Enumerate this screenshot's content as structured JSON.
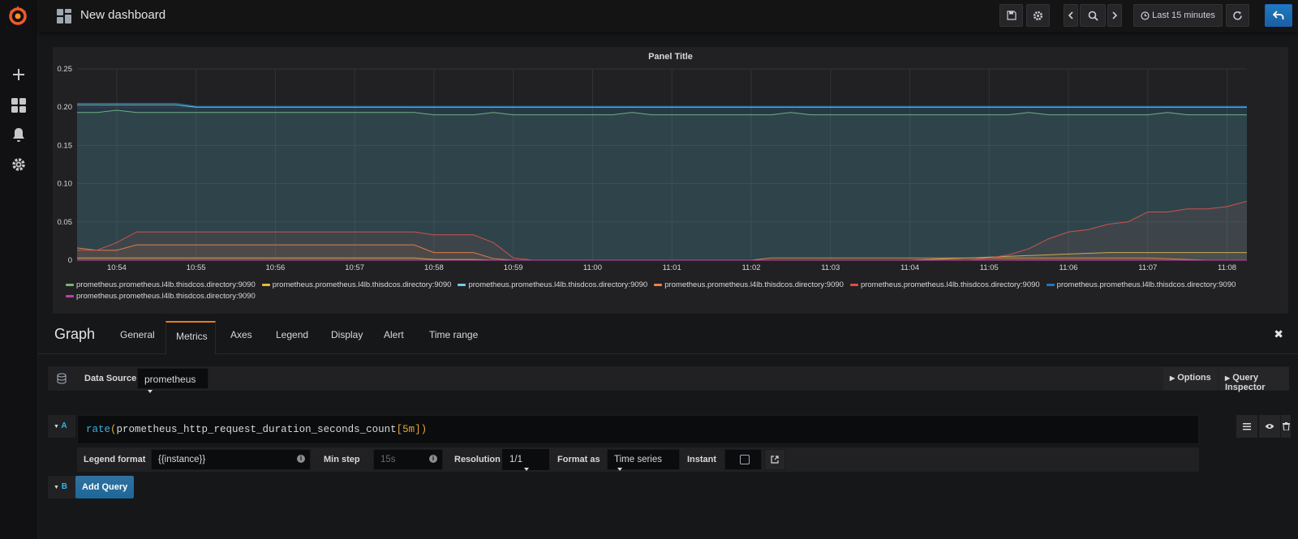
{
  "app": {
    "dashboard_title": "New dashboard",
    "time_range_label": "Last 15 minutes"
  },
  "panel": {
    "title": "Panel Title"
  },
  "chart_data": {
    "type": "area",
    "title": "Panel Title",
    "xlabel": "",
    "ylabel": "",
    "ylim": [
      0,
      0.25
    ],
    "y_ticks": [
      "0",
      "0.05",
      "0.10",
      "0.15",
      "0.20",
      "0.25"
    ],
    "x": [
      "10:53:30",
      "10:53:45",
      "10:54",
      "10:54:15",
      "10:54:30",
      "10:54:45",
      "10:55",
      "10:55:15",
      "10:55:30",
      "10:55:45",
      "10:56",
      "10:56:15",
      "10:56:30",
      "10:56:45",
      "10:57",
      "10:57:15",
      "10:57:30",
      "10:57:45",
      "10:58",
      "10:58:15",
      "10:58:30",
      "10:58:45",
      "10:59",
      "10:59:15",
      "10:59:30",
      "10:59:45",
      "11:00",
      "11:00:15",
      "11:00:30",
      "11:00:45",
      "11:01",
      "11:01:15",
      "11:01:30",
      "11:01:45",
      "11:02",
      "11:02:15",
      "11:02:30",
      "11:02:45",
      "11:03",
      "11:03:15",
      "11:03:30",
      "11:03:45",
      "11:04",
      "11:04:15",
      "11:04:30",
      "11:04:45",
      "11:05",
      "11:05:15",
      "11:05:30",
      "11:05:45",
      "11:06",
      "11:06:15",
      "11:06:30",
      "11:06:45",
      "11:07",
      "11:07:15",
      "11:07:30",
      "11:07:45",
      "11:08",
      "11:08:15"
    ],
    "x_ticks": [
      "10:54",
      "10:55",
      "10:56",
      "10:57",
      "10:58",
      "10:59",
      "11:00",
      "11:01",
      "11:02",
      "11:03",
      "11:04",
      "11:05",
      "11:06",
      "11:07",
      "11:08"
    ],
    "grid": true,
    "legend_position": "bottom",
    "series": [
      {
        "name": "prometheus.prometheus.l4lb.thisdcos.directory:9090",
        "color": "#7eb26d",
        "values": [
          0.193,
          0.193,
          0.196,
          0.193,
          0.193,
          0.193,
          0.193,
          0.193,
          0.193,
          0.193,
          0.193,
          0.193,
          0.193,
          0.193,
          0.193,
          0.193,
          0.193,
          0.193,
          0.19,
          0.19,
          0.19,
          0.193,
          0.19,
          0.19,
          0.19,
          0.19,
          0.19,
          0.19,
          0.193,
          0.19,
          0.19,
          0.19,
          0.19,
          0.19,
          0.19,
          0.19,
          0.193,
          0.19,
          0.19,
          0.19,
          0.19,
          0.19,
          0.19,
          0.19,
          0.19,
          0.19,
          0.19,
          0.19,
          0.193,
          0.19,
          0.19,
          0.19,
          0.19,
          0.19,
          0.19,
          0.193,
          0.19,
          0.19,
          0.19,
          0.19
        ]
      },
      {
        "name": "prometheus.prometheus.l4lb.thisdcos.directory:9090",
        "color": "#eab839",
        "values": [
          0.003,
          0.003,
          0.003,
          0.003,
          0.003,
          0.003,
          0.003,
          0.003,
          0.003,
          0.003,
          0.003,
          0.003,
          0.003,
          0.003,
          0.003,
          0.003,
          0.003,
          0.003,
          0.001,
          0.001,
          0.001,
          0.0,
          0.0,
          0.0,
          0.0,
          0.0,
          0.0,
          0.0,
          0.0,
          0.0,
          0.0,
          0.0,
          0.0,
          0.0,
          0.0,
          0.0,
          0.0,
          0.0,
          0.0,
          0.0,
          0.0,
          0.0,
          0.0,
          0.001,
          0.002,
          0.003,
          0.004,
          0.005,
          0.006,
          0.007,
          0.008,
          0.009,
          0.01,
          0.01,
          0.01,
          0.01,
          0.01,
          0.01,
          0.01,
          0.01
        ]
      },
      {
        "name": "prometheus.prometheus.l4lb.thisdcos.directory:9090",
        "color": "#6ed0e0",
        "values": [
          0.203,
          0.203,
          0.203,
          0.203,
          0.203,
          0.203,
          0.2,
          0.2,
          0.2,
          0.2,
          0.2,
          0.2,
          0.2,
          0.2,
          0.2,
          0.2,
          0.2,
          0.2,
          0.2,
          0.2,
          0.2,
          0.2,
          0.2,
          0.2,
          0.2,
          0.2,
          0.2,
          0.2,
          0.2,
          0.2,
          0.2,
          0.2,
          0.2,
          0.2,
          0.2,
          0.2,
          0.2,
          0.2,
          0.2,
          0.2,
          0.2,
          0.2,
          0.2,
          0.2,
          0.2,
          0.2,
          0.2,
          0.2,
          0.2,
          0.2,
          0.2,
          0.2,
          0.2,
          0.2,
          0.2,
          0.2,
          0.2,
          0.2,
          0.2,
          0.2
        ]
      },
      {
        "name": "prometheus.prometheus.l4lb.thisdcos.directory:9090",
        "color": "#ef843c",
        "values": [
          0.016,
          0.013,
          0.013,
          0.02,
          0.02,
          0.02,
          0.02,
          0.02,
          0.02,
          0.02,
          0.02,
          0.02,
          0.02,
          0.02,
          0.02,
          0.02,
          0.02,
          0.02,
          0.01,
          0.01,
          0.01,
          0.002,
          0.0,
          0.0,
          0.0,
          0.0,
          0.0,
          0.0,
          0.0,
          0.0,
          0.0,
          0.0,
          0.0,
          0.0,
          0.0,
          0.003,
          0.003,
          0.003,
          0.003,
          0.003,
          0.003,
          0.003,
          0.003,
          0.003,
          0.003,
          0.003,
          0.003,
          0.003,
          0.003,
          0.003,
          0.003,
          0.003,
          0.003,
          0.003,
          0.003,
          0.002,
          0.001,
          0.0,
          0.0,
          0.0
        ]
      },
      {
        "name": "prometheus.prometheus.l4lb.thisdcos.directory:9090",
        "color": "#e24d42",
        "values": [
          0.013,
          0.013,
          0.023,
          0.037,
          0.037,
          0.037,
          0.037,
          0.037,
          0.037,
          0.037,
          0.037,
          0.037,
          0.037,
          0.037,
          0.037,
          0.037,
          0.037,
          0.037,
          0.033,
          0.033,
          0.033,
          0.023,
          0.003,
          0.0,
          0.0,
          0.0,
          0.0,
          0.0,
          0.0,
          0.0,
          0.0,
          0.0,
          0.0,
          0.0,
          0.0,
          0.0,
          0.0,
          0.0,
          0.0,
          0.0,
          0.0,
          0.0,
          0.0,
          0.0,
          0.0,
          0.0,
          0.003,
          0.007,
          0.015,
          0.028,
          0.037,
          0.04,
          0.047,
          0.05,
          0.063,
          0.063,
          0.067,
          0.067,
          0.07,
          0.077
        ]
      },
      {
        "name": "prometheus.prometheus.l4lb.thisdcos.directory:9090",
        "color": "#1f78c1",
        "values": [
          0.205,
          0.205,
          0.205,
          0.205,
          0.205,
          0.205,
          0.201,
          0.201,
          0.201,
          0.201,
          0.201,
          0.201,
          0.201,
          0.201,
          0.201,
          0.201,
          0.201,
          0.201,
          0.201,
          0.201,
          0.201,
          0.201,
          0.201,
          0.201,
          0.201,
          0.201,
          0.201,
          0.201,
          0.201,
          0.201,
          0.201,
          0.201,
          0.201,
          0.201,
          0.201,
          0.201,
          0.201,
          0.201,
          0.201,
          0.201,
          0.201,
          0.201,
          0.201,
          0.201,
          0.201,
          0.201,
          0.201,
          0.201,
          0.201,
          0.201,
          0.201,
          0.201,
          0.201,
          0.201,
          0.201,
          0.201,
          0.201,
          0.201,
          0.201,
          0.201
        ]
      },
      {
        "name": "prometheus.prometheus.l4lb.thisdcos.directory:9090",
        "color": "#ba43a9",
        "values": [
          0.0,
          0.0,
          0.0,
          0.0,
          0.0,
          0.0,
          0.0,
          0.0,
          0.0,
          0.0,
          0.0,
          0.0,
          0.0,
          0.0,
          0.0,
          0.0,
          0.0,
          0.0,
          0.0,
          0.0,
          0.0,
          0.0,
          0.0,
          0.0,
          0.0,
          0.0,
          0.0,
          0.0,
          0.0,
          0.0,
          0.0,
          0.0,
          0.0,
          0.0,
          0.0,
          0.0,
          0.0,
          0.0,
          0.0,
          0.0,
          0.0,
          0.0,
          0.0,
          0.0,
          0.0,
          0.0,
          0.0,
          0.0,
          0.0,
          0.0,
          0.0,
          0.0,
          0.0,
          0.0,
          0.0,
          0.0,
          0.0,
          0.0,
          0.0,
          0.0
        ]
      }
    ]
  },
  "editor": {
    "panel_type": "Graph",
    "tabs": [
      "General",
      "Metrics",
      "Axes",
      "Legend",
      "Display",
      "Alert",
      "Time range"
    ],
    "active_tab": "Metrics",
    "datasource_label": "Data Source",
    "datasource_value": "prometheus",
    "options_label": "Options",
    "query_inspector_label": "Query Inspector",
    "query_a": {
      "letter": "A",
      "expr_fn": "rate",
      "expr_open": "(",
      "expr_metric": "prometheus_http_request_duration_seconds_count",
      "expr_range": "[5m]",
      "expr_close": ")",
      "legend_format_label": "Legend format",
      "legend_format_value": "{{instance}}",
      "min_step_label": "Min step",
      "min_step_placeholder": "15s",
      "resolution_label": "Resolution",
      "resolution_value": "1/1",
      "format_as_label": "Format as",
      "format_as_value": "Time series",
      "instant_label": "Instant"
    },
    "query_b": {
      "letter": "B",
      "add_query_label": "Add Query"
    }
  },
  "colors": {
    "accent": "#eb7b18",
    "primary_button": "#1c6899"
  }
}
